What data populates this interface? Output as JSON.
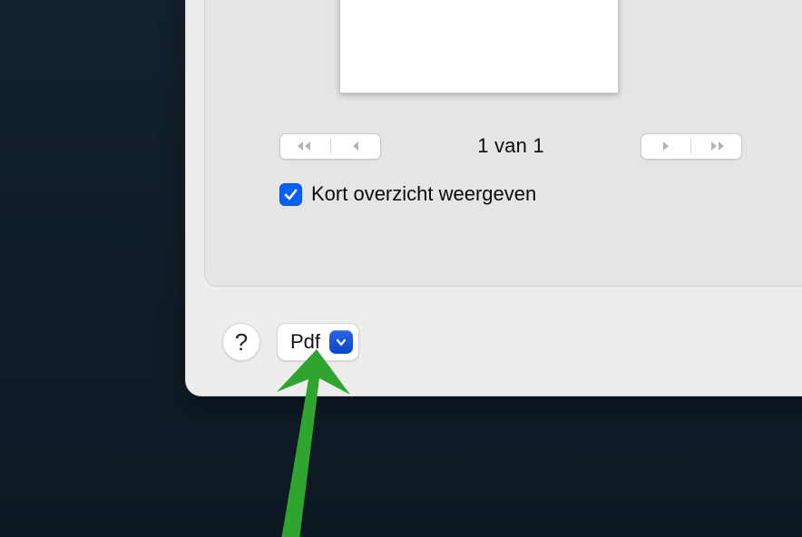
{
  "pager": {
    "label": "1 van 1"
  },
  "checkbox": {
    "label": "Kort overzicht weergeven",
    "checked": true
  },
  "footer": {
    "help_label": "?",
    "pdf_label": "Pdf"
  }
}
